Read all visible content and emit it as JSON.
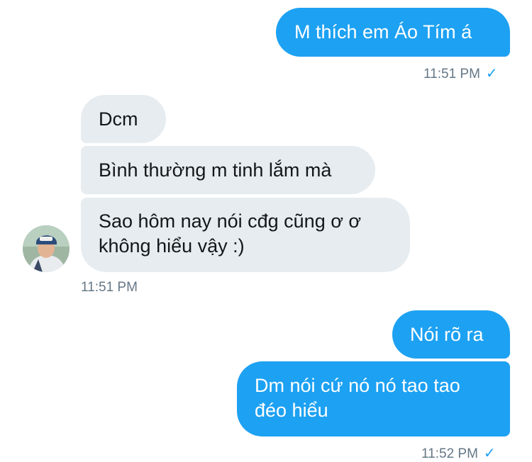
{
  "messages": [
    {
      "text": "M thích em Áo Tím á"
    },
    {
      "text": "Dcm"
    },
    {
      "text": "Bình thường m tinh lắm mà"
    },
    {
      "text_line1": "Sao hôm nay nói cđg cũng ơ ơ",
      "text_line2": "không hiểu vậy :)"
    },
    {
      "text": "Nói rõ ra"
    },
    {
      "text_line1": "Dm nói cứ nó nó tao tao",
      "text_line2": "đéo hiểu"
    }
  ],
  "timestamps": {
    "t1": "11:51 PM",
    "t2": "11:51 PM",
    "t3": "11:52 PM"
  },
  "status": {
    "read_check": "✓"
  },
  "colors": {
    "outgoing_bubble": "#1da1f2",
    "incoming_bubble": "#e6ecf0",
    "timestamp": "#657786"
  }
}
